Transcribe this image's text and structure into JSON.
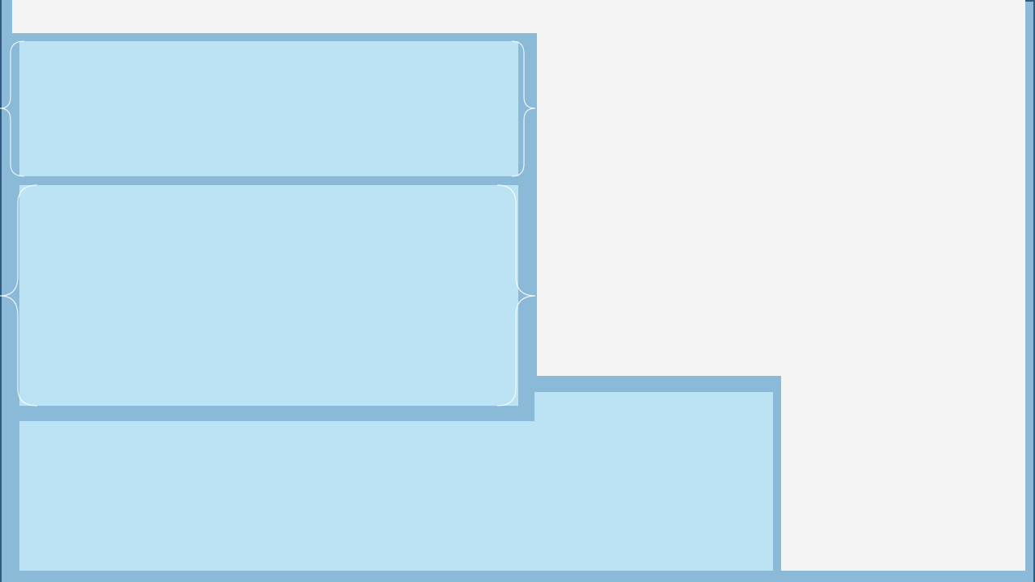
{
  "colors": {
    "background": "#f4f4f4",
    "frame": "#8bbad9",
    "frame_edge": "#2e5a82",
    "panel": "#bce3f3",
    "brace": "#ffffff"
  },
  "panels": [
    {
      "id": "top-left"
    },
    {
      "id": "middle-left"
    },
    {
      "id": "bottom"
    }
  ]
}
